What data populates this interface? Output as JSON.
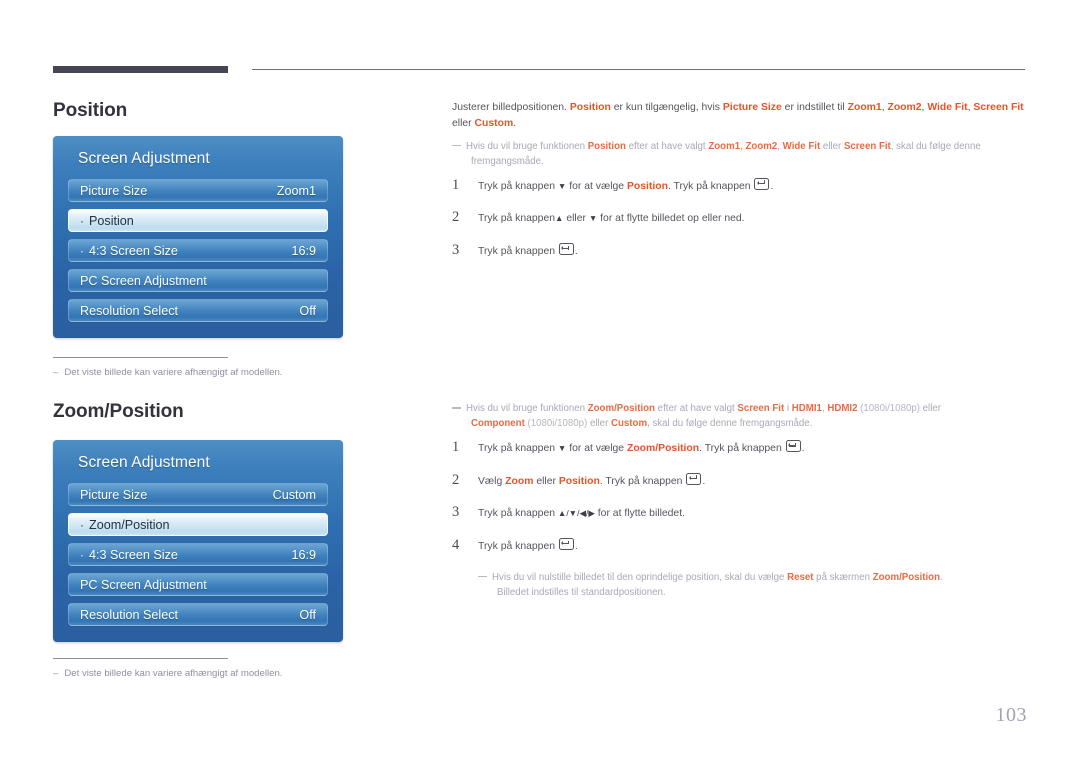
{
  "page": {
    "number": "103"
  },
  "sections": [
    {
      "heading": "Position",
      "osd": {
        "title": "Screen Adjustment",
        "rows": [
          {
            "label": "Picture Size",
            "value": "Zoom1",
            "selected": false,
            "indented": false
          },
          {
            "label": "Position",
            "value": "",
            "selected": true,
            "indented": true
          },
          {
            "label": "4:3 Screen Size",
            "value": "16:9",
            "selected": false,
            "indented": true
          },
          {
            "label": "PC Screen Adjustment",
            "value": "",
            "selected": false,
            "indented": false
          },
          {
            "label": "Resolution Select",
            "value": "Off",
            "selected": false,
            "indented": false
          }
        ]
      },
      "footnote": "Det viste billede kan variere afhængigt af modellen.",
      "footnote_dash": "–"
    },
    {
      "heading": "Zoom/Position",
      "osd": {
        "title": "Screen Adjustment",
        "rows": [
          {
            "label": "Picture Size",
            "value": "Custom",
            "selected": false,
            "indented": false
          },
          {
            "label": "Zoom/Position",
            "value": "",
            "selected": true,
            "indented": true
          },
          {
            "label": "4:3 Screen Size",
            "value": "16:9",
            "selected": false,
            "indented": true
          },
          {
            "label": "PC Screen Adjustment",
            "value": "",
            "selected": false,
            "indented": false
          },
          {
            "label": "Resolution Select",
            "value": "Off",
            "selected": false,
            "indented": false
          }
        ]
      },
      "footnote": "Det viste billede kan variere afhængigt af modellen.",
      "footnote_dash": "–"
    }
  ],
  "top_text": {
    "intro": {
      "part1": "Justerer billedpositionen. ",
      "kw1": "Position",
      "part2": " er kun tilgængelig, hvis ",
      "kw2": "Picture Size",
      "part3": " er indstillet til ",
      "kw3": "Zoom1",
      "sep1": ", ",
      "kw4": "Zoom2",
      "sep2": ", ",
      "kw5": "Wide Fit",
      "sep3": ", ",
      "kw6": "Screen Fit",
      "part4": " eller ",
      "kw7": "Custom",
      "part5": "."
    },
    "note": {
      "part1": "Hvis du vil bruge funktionen ",
      "kw1": "Position",
      "part2": " efter at have valgt ",
      "kw2": "Zoom1",
      "sep1": ", ",
      "kw3": "Zoom2",
      "sep2": ", ",
      "kw4": "Wide Fit",
      "part3": " eller ",
      "kw5": "Screen Fit",
      "part4": ", skal du følge denne",
      "line2": "fremgangsmåde."
    },
    "steps": [
      {
        "num": "1",
        "p1": "Tryk på knappen ",
        "arrow": "▼",
        "p2": " for at vælge ",
        "kw": "Position",
        "p3": ". Tryk på knappen ",
        "p4": "."
      },
      {
        "num": "2",
        "p1": "Tryk på knappen",
        "arrow": "▲",
        "p2": " eller ",
        "arrow2": "▼",
        "p3": " for at flytte billedet op eller ned.",
        "kw": "",
        "p4": ""
      },
      {
        "num": "3",
        "p1": "Tryk på knappen ",
        "arrow": "",
        "p2": "",
        "kw": "",
        "p3": "",
        "p4": "."
      }
    ]
  },
  "bottom_text": {
    "note": {
      "part1": "Hvis du vil bruge funktionen ",
      "kw1": "Zoom/Position",
      "part2": " efter at have valgt ",
      "kw2": "Screen Fit",
      "part3": " i ",
      "kw3": "HDMI1",
      "sep1": ", ",
      "kw4": "HDMI2",
      "dim1": " (1080i/1080p)",
      "part4": " eller",
      "line2_kw": "Component",
      "line2_dim": " (1080i/1080p)",
      "line2_part": " eller ",
      "line2_kw2": "Custom",
      "line2_end": ", skal du følge denne fremgangsmåde."
    },
    "steps": [
      {
        "num": "1",
        "p1": "Tryk på knappen ",
        "arrow": "▼",
        "p2": " for at vælge ",
        "kw": "Zoom/Position",
        "p3": ". Tryk på knappen ",
        "p4": "."
      },
      {
        "num": "2",
        "p1": "Vælg ",
        "kwa": "Zoom",
        "p2": " eller ",
        "kw": "Position",
        "p3": ". Tryk på knappen ",
        "p4": "."
      },
      {
        "num": "3",
        "p1": "Tryk på knappen ",
        "arrow": "▲/▼/◀/▶",
        "p2": " for at flytte billedet.",
        "kw": "",
        "p3": "",
        "p4": ""
      },
      {
        "num": "4",
        "p1": "Tryk på knappen ",
        "arrow": "",
        "p2": "",
        "kw": "",
        "p3": "",
        "p4": "."
      }
    ],
    "reset_note": {
      "part1": "Hvis du vil nulstille billedet til den oprindelige position, skal du vælge ",
      "kw1": "Reset",
      "part2": " på skærmen ",
      "kw2": "Zoom/Position",
      "part3": ".",
      "line2": "Billedet indstilles til standardpositionen."
    }
  }
}
